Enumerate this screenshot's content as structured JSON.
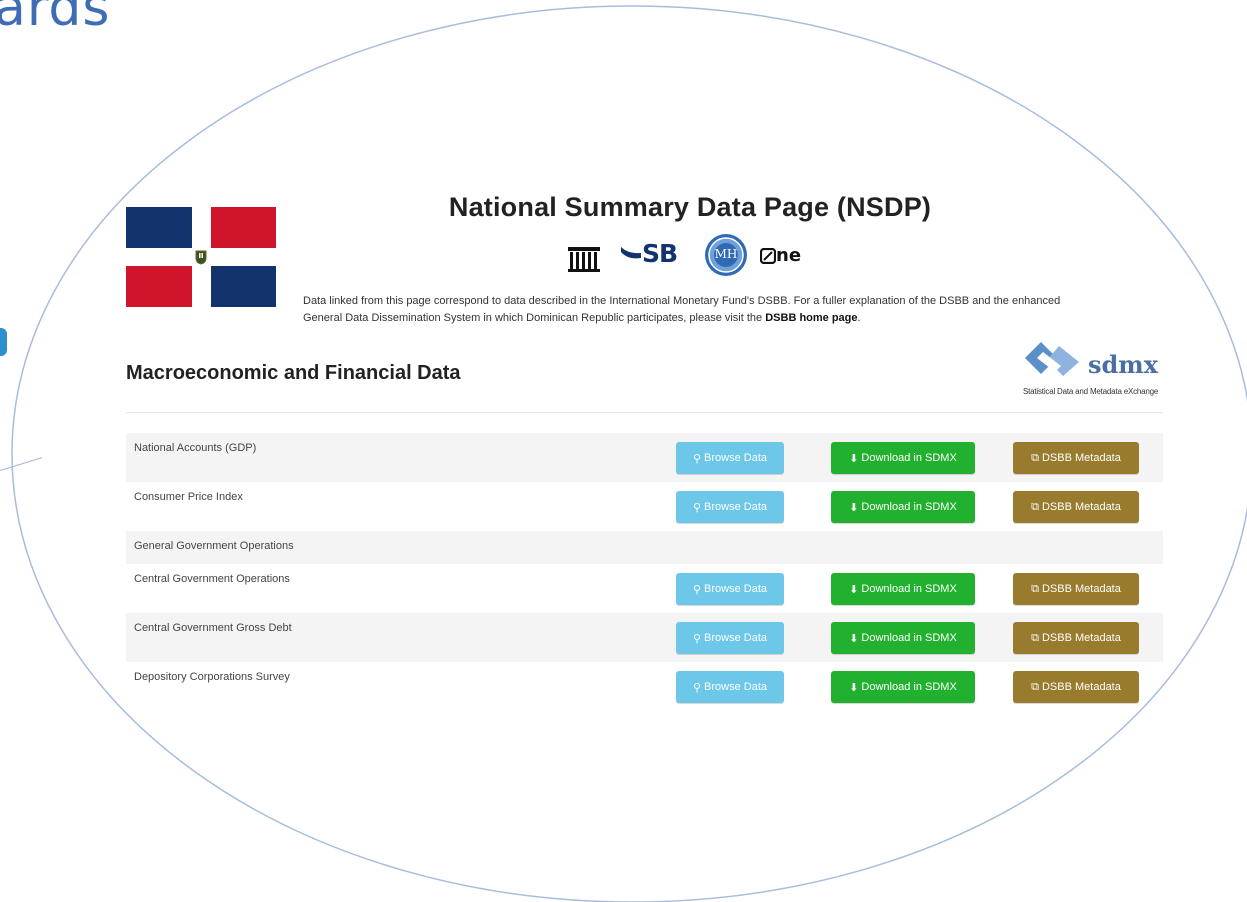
{
  "slide": {
    "title_fragment": "ards"
  },
  "header": {
    "title": "National Summary Data Page (NSDP)",
    "logos": [
      {
        "name": "central-bank-logo"
      },
      {
        "name": "sb-logo",
        "text": "SB"
      },
      {
        "name": "mh-seal-logo",
        "text": "MH"
      },
      {
        "name": "one-logo",
        "text": "ne"
      }
    ],
    "intro_text": "Data linked from this page correspond to data described in the International Monetary Fund's DSBB. For a fuller explanation of the DSBB and the enhanced General Data Dissemination System in which Dominican Republic participates, please visit the ",
    "intro_link": "DSBB home page",
    "intro_end": "."
  },
  "section": {
    "title": "Macroeconomic and Financial Data",
    "sdmx_logo": {
      "word": "sdmx",
      "subtitle": "Statistical Data and Metadata eXchange"
    }
  },
  "buttons": {
    "browse": "Browse Data",
    "download": "Download in SDMX",
    "metadata": "DSBB Metadata"
  },
  "rows": [
    {
      "label": "National Accounts (GDP)",
      "has_buttons": true
    },
    {
      "label": "Consumer Price Index",
      "has_buttons": true
    },
    {
      "label": "General Government Operations",
      "has_buttons": false
    },
    {
      "label": "Central Government Operations",
      "has_buttons": true
    },
    {
      "label": "Central Government Gross Debt",
      "has_buttons": true
    },
    {
      "label": "Depository Corporations Survey",
      "has_buttons": true
    }
  ],
  "colors": {
    "browse": "#6cc7e8",
    "download": "#22b12e",
    "metadata": "#987b2c",
    "flag_blue": "#12336d",
    "flag_red": "#cf142b",
    "slide_title": "#3e6db5"
  }
}
